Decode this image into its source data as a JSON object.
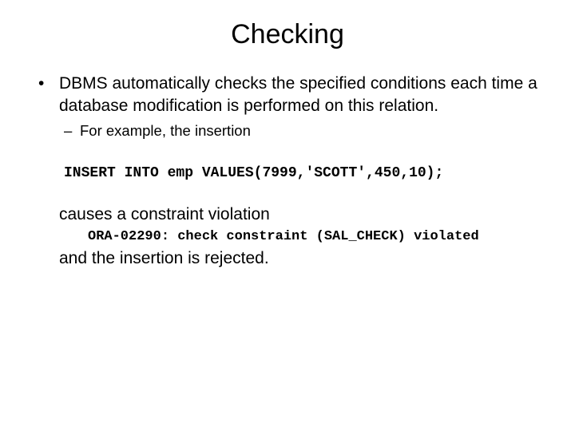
{
  "title": "Checking",
  "bullet_main": "DBMS automatically checks the specified conditions each time a database modification is performed on this relation.",
  "bullet_sub": "For example, the insertion",
  "code1": "INSERT INTO emp VALUES(7999,'SCOTT',450,10);",
  "body1": "causes a constraint violation",
  "code2": "ORA-02290: check constraint (SAL_CHECK) violated",
  "body2": "and the insertion is rejected."
}
